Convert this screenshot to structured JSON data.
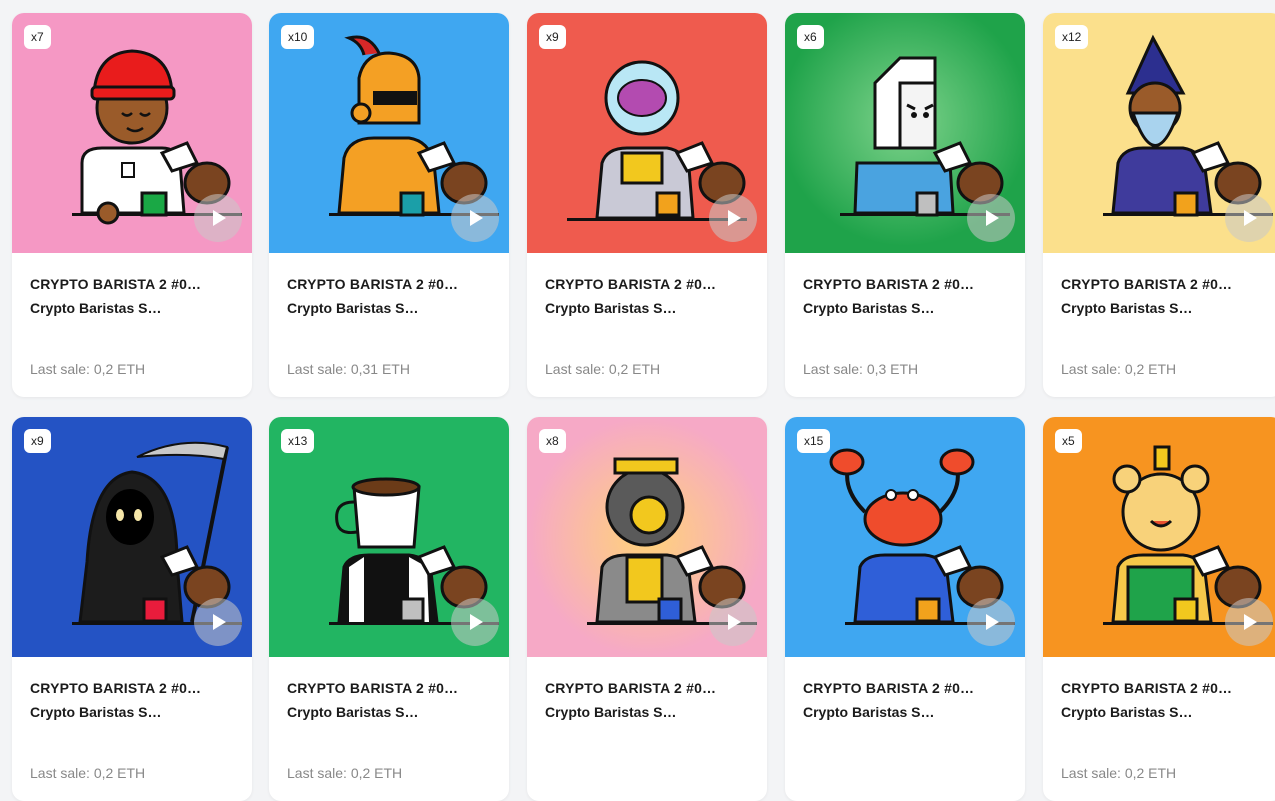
{
  "cards": [
    {
      "badge": "x7",
      "title": "CRYPTO BARISTA 2 #0…",
      "collection": "Crypto Baristas S…",
      "sale": "Last sale: 0,2 ETH",
      "bg": "#f598c4",
      "character": "barista-red-beanie"
    },
    {
      "badge": "x10",
      "title": "CRYPTO BARISTA 2 #0…",
      "collection": "Crypto Baristas S…",
      "sale": "Last sale: 0,31 ETH",
      "bg": "#3fa7f1",
      "character": "knight"
    },
    {
      "badge": "x9",
      "title": "CRYPTO BARISTA 2 #0…",
      "collection": "Crypto Baristas S…",
      "sale": "Last sale: 0,2 ETH",
      "bg": "#ef5b4e",
      "character": "brain-jar-robot"
    },
    {
      "badge": "x6",
      "title": "CRYPTO BARISTA 2 #0…",
      "collection": "Crypto Baristas S…",
      "sale": "Last sale: 0,3 ETH",
      "bg": "#1fa34a",
      "character": "milk-carton"
    },
    {
      "badge": "x12",
      "title": "CRYPTO BARISTA 2 #0…",
      "collection": "Crypto Baristas S…",
      "sale": "Last sale: 0,2 ETH",
      "bg": "#fbe08c",
      "character": "wizard"
    },
    {
      "badge": "x9",
      "title": "CRYPTO BARISTA 2 #0…",
      "collection": "Crypto Baristas S…",
      "sale": "Last sale: 0,2 ETH",
      "bg": "#2453c4",
      "character": "grim-reaper"
    },
    {
      "badge": "x13",
      "title": "CRYPTO BARISTA 2 #0…",
      "collection": "Crypto Baristas S…",
      "sale": "Last sale: 0,2 ETH",
      "bg": "#22b562",
      "character": "coffee-mug"
    },
    {
      "badge": "x8",
      "title": "CRYPTO BARISTA 2 #0…",
      "collection": "Crypto Baristas S…",
      "sale": "",
      "bg": "#f6a9c6",
      "character": "diver-robot"
    },
    {
      "badge": "x15",
      "title": "CRYPTO BARISTA 2 #0…",
      "collection": "Crypto Baristas S…",
      "sale": "",
      "bg": "#3fa7f1",
      "character": "crab"
    },
    {
      "badge": "x5",
      "title": "CRYPTO BARISTA 2 #0…",
      "collection": "Crypto Baristas S…",
      "sale": "Last sale: 0,2 ETH",
      "bg": "#f79420",
      "character": "honey-bear"
    }
  ],
  "icons": {
    "play": "play-icon"
  }
}
